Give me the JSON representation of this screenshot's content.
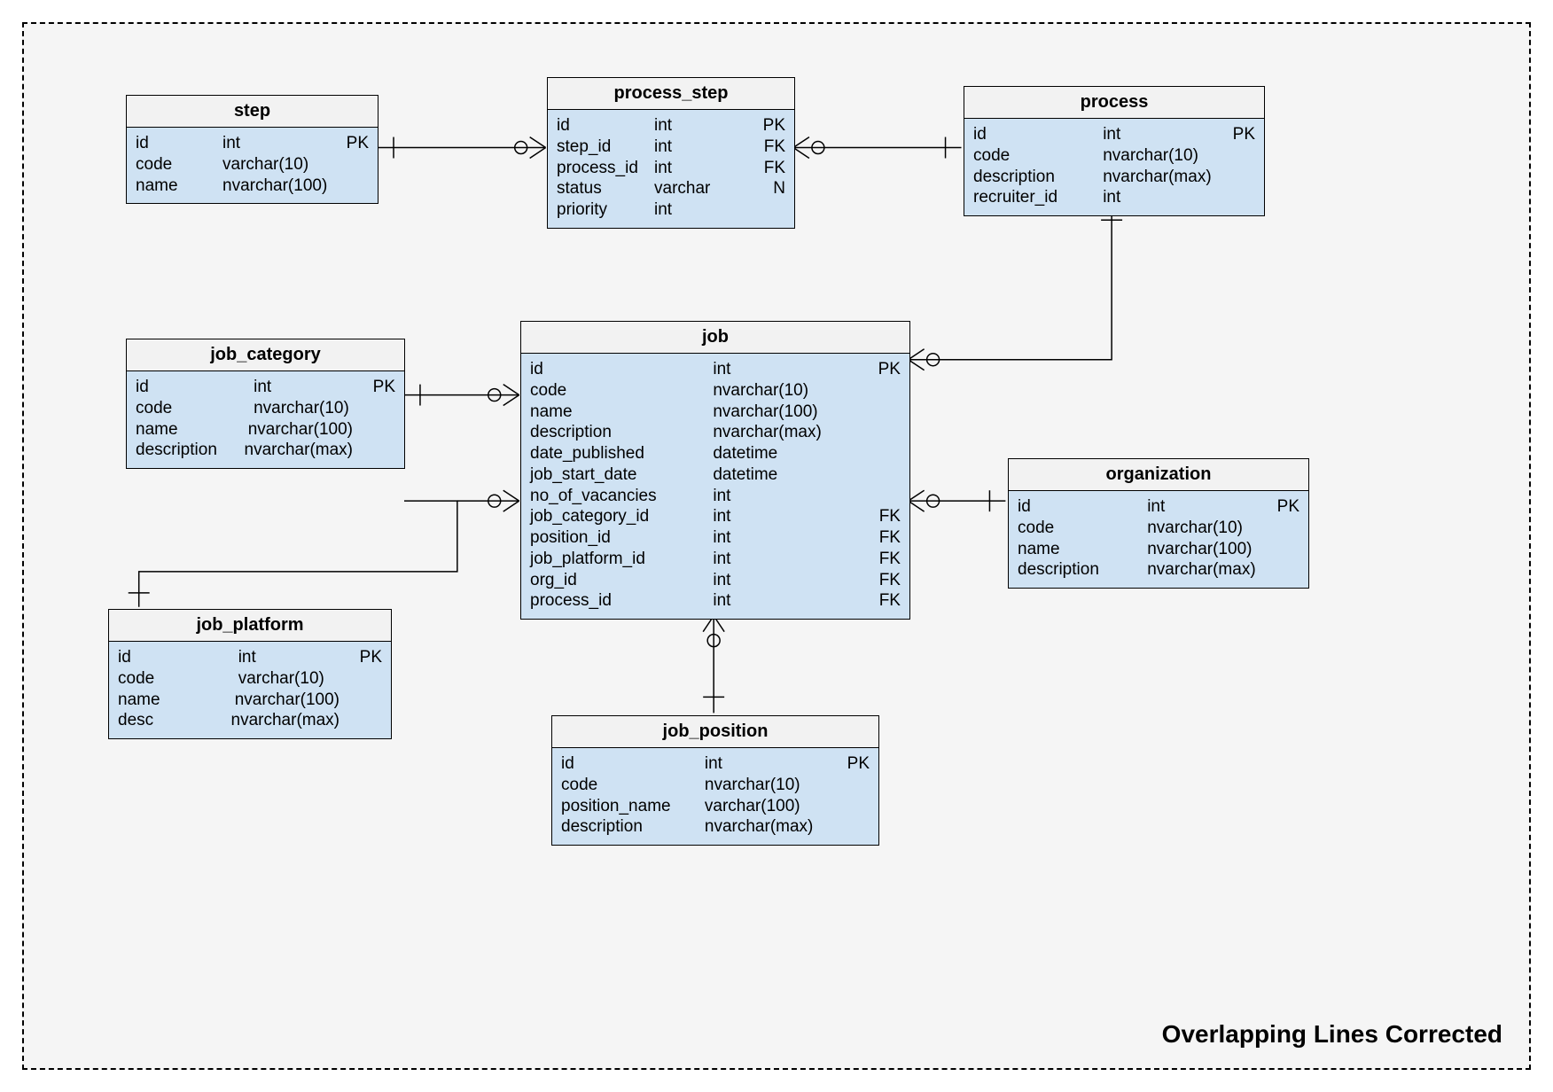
{
  "label": "Overlapping Lines Corrected",
  "entities": {
    "step": {
      "title": "step",
      "rows": [
        {
          "name": "id",
          "type": "int",
          "key": "PK"
        },
        {
          "name": "code",
          "type": "varchar(10)",
          "key": ""
        },
        {
          "name": "name",
          "type": "nvarchar(100)",
          "key": ""
        }
      ]
    },
    "process_step": {
      "title": "process_step",
      "rows": [
        {
          "name": "id",
          "type": "int",
          "key": "PK"
        },
        {
          "name": "step_id",
          "type": "int",
          "key": "FK"
        },
        {
          "name": "process_id",
          "type": "int",
          "key": "FK"
        },
        {
          "name": "status",
          "type": "varchar",
          "key": "N"
        },
        {
          "name": "priority",
          "type": "int",
          "key": ""
        }
      ]
    },
    "process": {
      "title": "process",
      "rows": [
        {
          "name": "id",
          "type": "int",
          "key": "PK"
        },
        {
          "name": "code",
          "type": "nvarchar(10)",
          "key": ""
        },
        {
          "name": "description",
          "type": "nvarchar(max)",
          "key": ""
        },
        {
          "name": "recruiter_id",
          "type": "int",
          "key": ""
        }
      ]
    },
    "job_category": {
      "title": "job_category",
      "rows": [
        {
          "name": "id",
          "type": "int",
          "key": "PK"
        },
        {
          "name": "code",
          "type": "nvarchar(10)",
          "key": ""
        },
        {
          "name": "name",
          "type": "nvarchar(100)",
          "key": ""
        },
        {
          "name": "description",
          "type": "nvarchar(max)",
          "key": ""
        }
      ]
    },
    "job": {
      "title": "job",
      "rows": [
        {
          "name": "id",
          "type": "int",
          "key": "PK"
        },
        {
          "name": "code",
          "type": "nvarchar(10)",
          "key": ""
        },
        {
          "name": "name",
          "type": "nvarchar(100)",
          "key": ""
        },
        {
          "name": "description",
          "type": "nvarchar(max)",
          "key": ""
        },
        {
          "name": "date_published",
          "type": "datetime",
          "key": ""
        },
        {
          "name": "job_start_date",
          "type": "datetime",
          "key": ""
        },
        {
          "name": "no_of_vacancies",
          "type": "int",
          "key": ""
        },
        {
          "name": "job_category_id",
          "type": "int",
          "key": "FK"
        },
        {
          "name": "position_id",
          "type": "int",
          "key": "FK"
        },
        {
          "name": "job_platform_id",
          "type": "int",
          "key": "FK"
        },
        {
          "name": "org_id",
          "type": "int",
          "key": "FK"
        },
        {
          "name": "process_id",
          "type": "int",
          "key": "FK"
        }
      ]
    },
    "job_platform": {
      "title": "job_platform",
      "rows": [
        {
          "name": "id",
          "type": "int",
          "key": "PK"
        },
        {
          "name": "code",
          "type": "varchar(10)",
          "key": ""
        },
        {
          "name": "name",
          "type": "nvarchar(100)",
          "key": ""
        },
        {
          "name": "desc",
          "type": "nvarchar(max)",
          "key": ""
        }
      ]
    },
    "organization": {
      "title": "organization",
      "rows": [
        {
          "name": "id",
          "type": "int",
          "key": "PK"
        },
        {
          "name": "code",
          "type": "nvarchar(10)",
          "key": ""
        },
        {
          "name": "name",
          "type": "nvarchar(100)",
          "key": ""
        },
        {
          "name": "description",
          "type": "nvarchar(max)",
          "key": ""
        }
      ]
    },
    "job_position": {
      "title": "job_position",
      "rows": [
        {
          "name": "id",
          "type": "int",
          "key": "PK"
        },
        {
          "name": "code",
          "type": "nvarchar(10)",
          "key": ""
        },
        {
          "name": "position_name",
          "type": "varchar(100)",
          "key": ""
        },
        {
          "name": "description",
          "type": "nvarchar(max)",
          "key": ""
        }
      ]
    }
  }
}
